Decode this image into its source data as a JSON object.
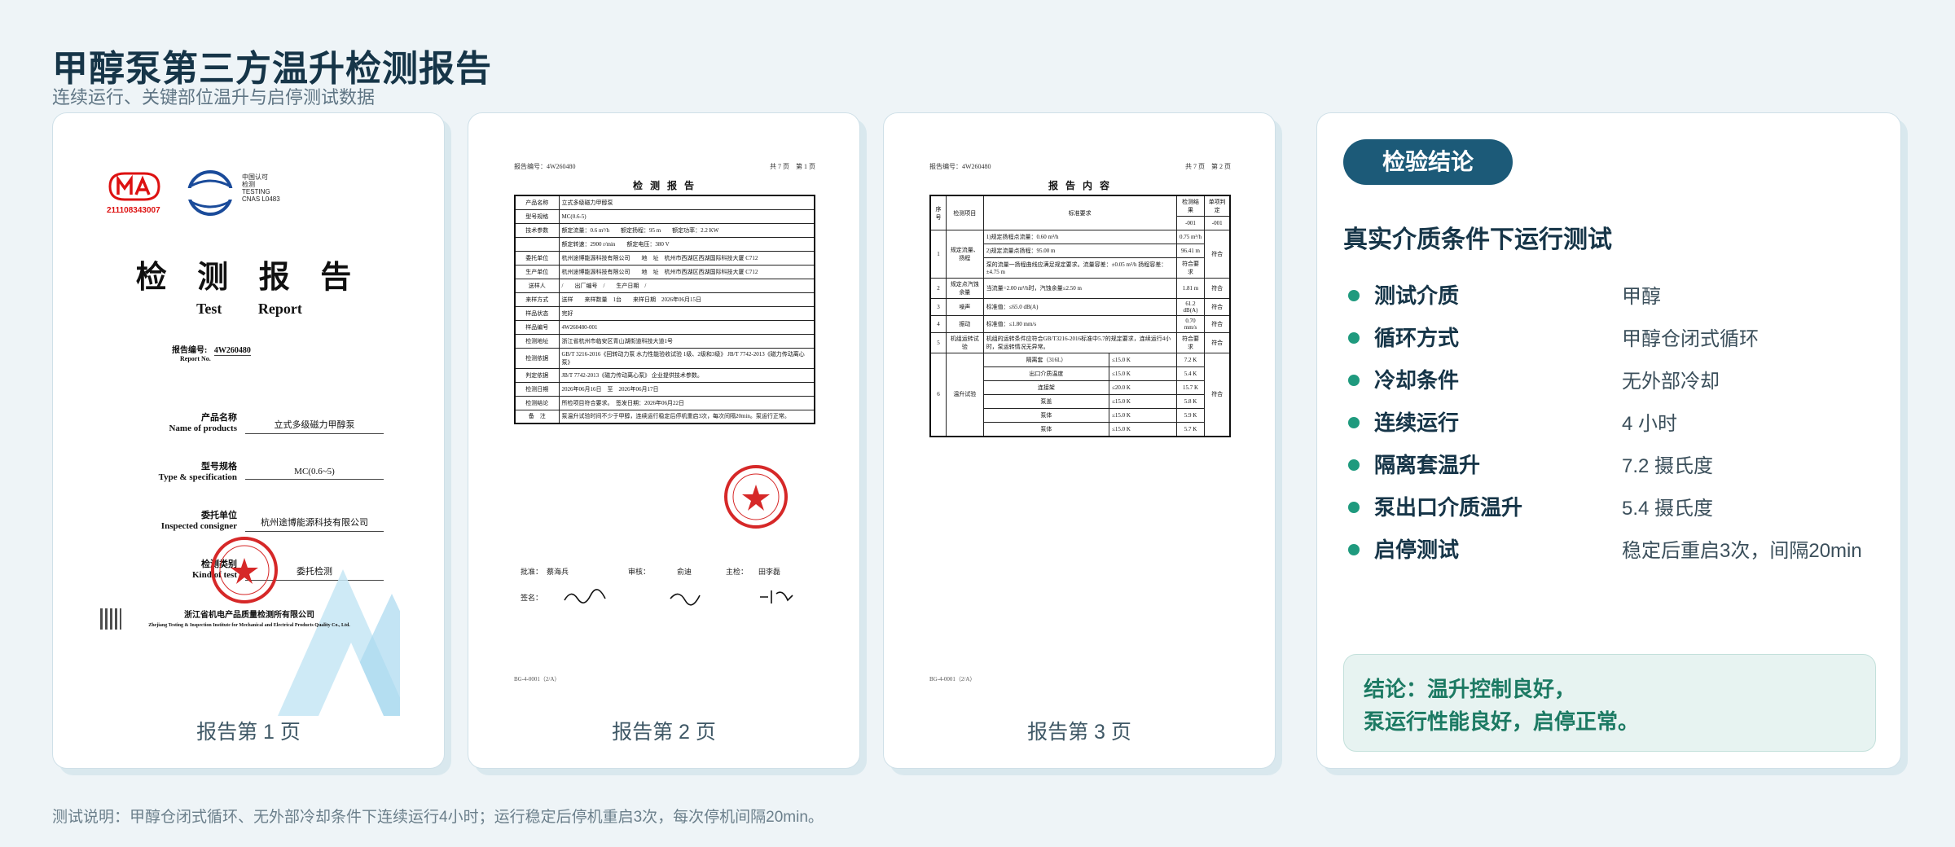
{
  "header": {
    "title": "甲醇泵第三方温升检测报告",
    "subtitle": "连续运行、关键部位温升与启停测试数据"
  },
  "pages": [
    {
      "caption": "报告第 1 页",
      "ma_number": "211108343007",
      "cnas_text": "中国认可\n检测\nTESTING\nCNAS L0483",
      "title_cn": "检 测 报 告",
      "title_en": "Test Report",
      "report_no_label": "报告编号:",
      "report_no_en": "Report No.",
      "report_no": "4W260480",
      "fields": [
        {
          "label": "产品名称",
          "label_en": "Name of products",
          "value": "立式多级磁力甲醇泵"
        },
        {
          "label": "型号规格",
          "label_en": "Type & specification",
          "value": "MC(0.6~5)"
        },
        {
          "label": "委托单位",
          "label_en": "Inspected consigner",
          "value": "杭州途博能源科技有限公司"
        },
        {
          "label": "检测类别",
          "label_en": "Kind of test",
          "value": "委托检测"
        }
      ],
      "org_cn": "浙江省机电产品质量检测所有限公司",
      "org_en": "Zhejiang Testing & Inspection Institute for Mechanical and Electrical Products Quality Co., Ltd."
    },
    {
      "caption": "报告第 2 页",
      "report_no": "报告编号：4W260480",
      "page_no": "共 7 页　第 1 页",
      "heading": "检 测 报 告",
      "rows": [
        [
          "产品名称",
          "立式多级磁力甲醇泵"
        ],
        [
          "型号规格",
          "MC(0.6-5)"
        ],
        [
          "技术参数",
          "额定流量：0.6 m³/h　　额定扬程：95 m　　额定功率：2.2 KW"
        ],
        [
          "",
          "额定转速：2900 r/min　　额定电压：380 V"
        ],
        [
          "委托单位",
          "杭州途博能源科技有限公司　　地　址　杭州市西湖区西湖国际科技大厦 C712"
        ],
        [
          "生产单位",
          "杭州途博能源科技有限公司　　地　址　杭州市西湖区西湖国际科技大厦 C712"
        ],
        [
          "送样人",
          "/　　出厂编号　/　　生产日期　/"
        ],
        [
          "来样方式",
          "送样　　来样数量　1台　　来样日期　2026年06月15日"
        ],
        [
          "样品状态",
          "完好"
        ],
        [
          "样品编号",
          "4W260480-001"
        ],
        [
          "检测地址",
          "浙江省杭州市临安区青山湖街道科技大道1号"
        ],
        [
          "检测依据",
          "GB/T 3216-2016《回转动力泵 水力性能验收试验 1级、2级和3级》 JB/T 7742-2013《磁力传动离心泵》"
        ],
        [
          "判定依据",
          "JB/T 7742-2013《磁力传动离心泵》 企业提供技术参数。"
        ],
        [
          "检测日期",
          "2026年06月16日　至　2026年06月17日"
        ],
        [
          "检测结论",
          "所检项目符合要求。　签发日期：2026年06月22日"
        ],
        [
          "备　注",
          "泵温升试验时间不少于甲醇，连续运行稳定后停机重启3次，每次间隔20min。泵运行正常。"
        ]
      ],
      "signatures": [
        {
          "role": "批准：",
          "name": "蔡海兵"
        },
        {
          "role": "审核：",
          "name": "俞迪"
        },
        {
          "role": "主检：",
          "name": "田李磊"
        }
      ],
      "sign_label": "签名：",
      "footer_code": "BG-4-0001（2/A）"
    },
    {
      "caption": "报告第 3 页",
      "report_no": "报告编号：4W260480",
      "page_no": "共 7 页　第 2 页",
      "heading": "报 告 内 容",
      "columns": [
        "序号",
        "检测项目",
        "标准要求",
        "检测结果",
        "单项判定"
      ],
      "sub_cols": [
        "-001",
        "-001"
      ],
      "rows": [
        {
          "no": "1",
          "item": "规定流量、扬程",
          "req": [
            "1)规定扬程点流量：0.60 m³/h",
            "2)规定流量点扬程：95.00 m",
            "泵的流量一扬程曲线应满足规定要求。流量容差：±0.05 m³/h 扬程容差：±4.75 m"
          ],
          "res": [
            "0.75 m³/h",
            "96.41 m",
            "符合要求"
          ],
          "judge": "符合"
        },
        {
          "no": "2",
          "item": "规定点汽蚀余量",
          "req": [
            "当流量=2.00 m³/h时，汽蚀余量≤2.50 m"
          ],
          "res": [
            "1.81 m"
          ],
          "judge": "符合"
        },
        {
          "no": "3",
          "item": "噪声",
          "req": [
            "标准值：≤65.0 dB(A)"
          ],
          "res": [
            "61.2 dB(A)"
          ],
          "judge": "符合"
        },
        {
          "no": "4",
          "item": "振动",
          "req": [
            "标准值：≤1.80 mm/s"
          ],
          "res": [
            "0.70 mm/s"
          ],
          "judge": "符合"
        },
        {
          "no": "5",
          "item": "机组运转试验",
          "req": [
            "机组的运转条件应符合GB/T3216-2016标准中5.7的规定要求，连续运行4小时，泵运转情况无异常。"
          ],
          "res": [
            "符合要求"
          ],
          "judge": "符合"
        },
        {
          "no": "6",
          "item": "温升试验",
          "parts": [
            {
              "part": "隔离套（316L）",
              "req": "≤15.0 K",
              "res": "7.2 K"
            },
            {
              "part": "出口介质温度",
              "req": "≤15.0 K",
              "res": "5.4 K"
            },
            {
              "part": "连接架",
              "req": "≤20.0 K",
              "res": "15.7 K"
            },
            {
              "part": "泵盖",
              "req": "≤15.0 K",
              "res": "5.8 K"
            },
            {
              "part": "泵体",
              "req": "≤15.0 K",
              "res": "5.9 K"
            },
            {
              "part": "泵体",
              "req": "≤15.0 K",
              "res": "5.7 K"
            }
          ],
          "judge": "符合"
        }
      ],
      "footer_code": "BG-4-0001（2/A）"
    }
  ],
  "conclusion": {
    "badge": "检验结论",
    "heading": "真实介质条件下运行测试",
    "items": [
      {
        "key": "测试介质",
        "value": "甲醇"
      },
      {
        "key": "循环方式",
        "value": "甲醇仓闭式循环"
      },
      {
        "key": "冷却条件",
        "value": "无外部冷却"
      },
      {
        "key": "连续运行",
        "value": "4 小时"
      },
      {
        "key": "隔离套温升",
        "value": "7.2 摄氏度"
      },
      {
        "key": "泵出口介质温升",
        "value": "5.4 摄氏度"
      },
      {
        "key": "启停测试",
        "value": "稳定后重启3次，间隔20min"
      }
    ],
    "summary_line1": "结论：温升控制良好，",
    "summary_line2": "泵运行性能良好，启停正常。"
  },
  "footnote": "测试说明：甲醇仓闭式循环、无外部冷却条件下连续运行4小时；运行稳定后停机重启3次，每次停机间隔20min。",
  "colors": {
    "accent": "#1c5a78",
    "dot": "#1f9a7e",
    "summary": "#1c7a63",
    "seal": "#d62828"
  }
}
